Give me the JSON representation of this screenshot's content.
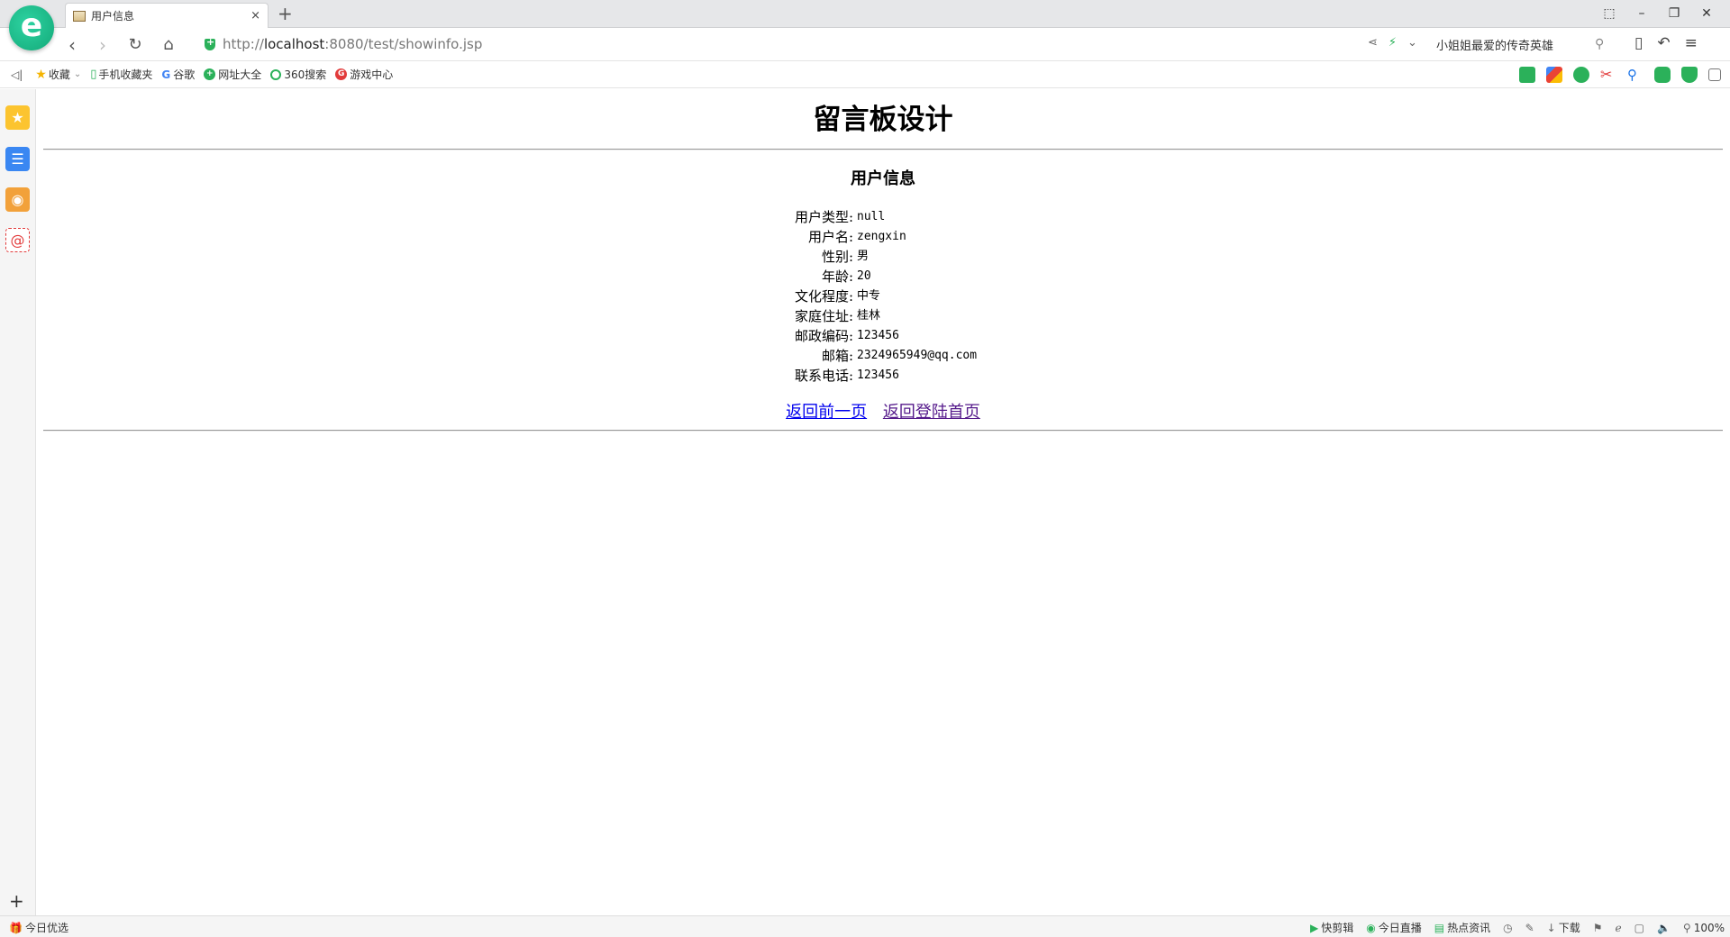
{
  "browser": {
    "tab_title": "用户信息",
    "tab_close": "×",
    "new_tab": "+",
    "url_host": "http://localhost",
    "url_rest": ":8080/test/showinfo.jsp",
    "search_text": "小姐姐最爱的传奇英雄",
    "window_controls": [
      "⬚",
      "–",
      "❐",
      "✕"
    ]
  },
  "bookmarks": [
    {
      "label": "收藏",
      "icon": "star-icon",
      "color": "#f5b400",
      "glyph": "★"
    },
    {
      "label": "手机收藏夹",
      "icon": "phone-icon",
      "color": "#2bb15a",
      "glyph": "▯"
    },
    {
      "label": "谷歌",
      "icon": "google-icon",
      "color": "#4285f4",
      "glyph": "G"
    },
    {
      "label": "网址大全",
      "icon": "sites-icon",
      "color": "#2bb15a",
      "glyph": "+"
    },
    {
      "label": "360搜索",
      "icon": "search360-icon",
      "color": "#2bb15a",
      "glyph": "○"
    },
    {
      "label": "游戏中心",
      "icon": "game-icon",
      "color": "#e23b3b",
      "glyph": "G"
    }
  ],
  "page": {
    "title": "留言板设计",
    "subtitle": "用户信息",
    "fields": [
      {
        "label": "用户类型:",
        "value": "null"
      },
      {
        "label": "用户名:",
        "value": "zengxin"
      },
      {
        "label": "性别:",
        "value": "男"
      },
      {
        "label": "年龄:",
        "value": "20"
      },
      {
        "label": "文化程度:",
        "value": "中专"
      },
      {
        "label": "家庭住址:",
        "value": "桂林"
      },
      {
        "label": "邮政编码:",
        "value": "123456"
      },
      {
        "label": "邮箱:",
        "value": "2324965949@qq.com"
      },
      {
        "label": "联系电话:",
        "value": "123456"
      }
    ],
    "link_back": "返回前一页",
    "link_home": "返回登陆首页"
  },
  "statusbar": {
    "left": "今日优选",
    "items": [
      "快剪辑",
      "今日直播",
      "热点资讯",
      "下载",
      "100%"
    ]
  }
}
